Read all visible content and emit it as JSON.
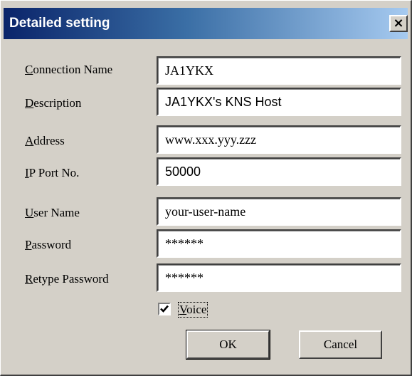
{
  "window": {
    "title": "Detailed setting",
    "close_glyph": "×"
  },
  "fields": [
    {
      "label": "Connection Name",
      "accel": "C",
      "label_rest": "onnection Name",
      "value": "JA1YKX"
    },
    {
      "label": "Description",
      "accel": "D",
      "label_rest": "escription",
      "value": "JA1YKX's KNS Host"
    },
    {
      "label": "Address",
      "accel": "A",
      "label_rest": "ddress",
      "value": "www.xxx.yyy.zzz"
    },
    {
      "label": "IP Port No.",
      "accel": "I",
      "label_rest": "P Port No.",
      "value": "50000"
    },
    {
      "label": "User Name",
      "accel": "U",
      "label_rest": "ser Name",
      "value": "your-user-name"
    },
    {
      "label": "Password",
      "accel": "P",
      "label_rest": "assword",
      "value": "******"
    },
    {
      "label": "Retype Password",
      "accel": "R",
      "label_rest": "etype Password",
      "value": "******"
    }
  ],
  "voice": {
    "label": "Voice",
    "accel": "V",
    "label_rest": "oice",
    "checked": true
  },
  "buttons": {
    "ok": "OK",
    "cancel": "Cancel"
  }
}
